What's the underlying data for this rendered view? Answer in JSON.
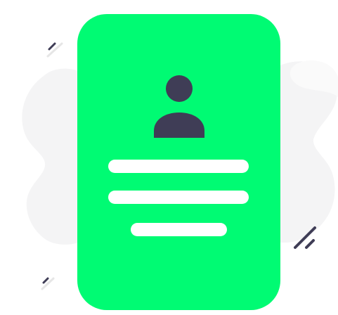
{
  "illustration": {
    "subject": "profile-card",
    "colors": {
      "card": "#00fb73",
      "avatar": "#3f3d56",
      "text_line": "#ffffff",
      "backdrop_blob": "#f2f2f2",
      "dark_stroke": "#3f3d56",
      "light_stroke": "#e6e6e6"
    },
    "icons": [
      "user-avatar-icon"
    ]
  }
}
